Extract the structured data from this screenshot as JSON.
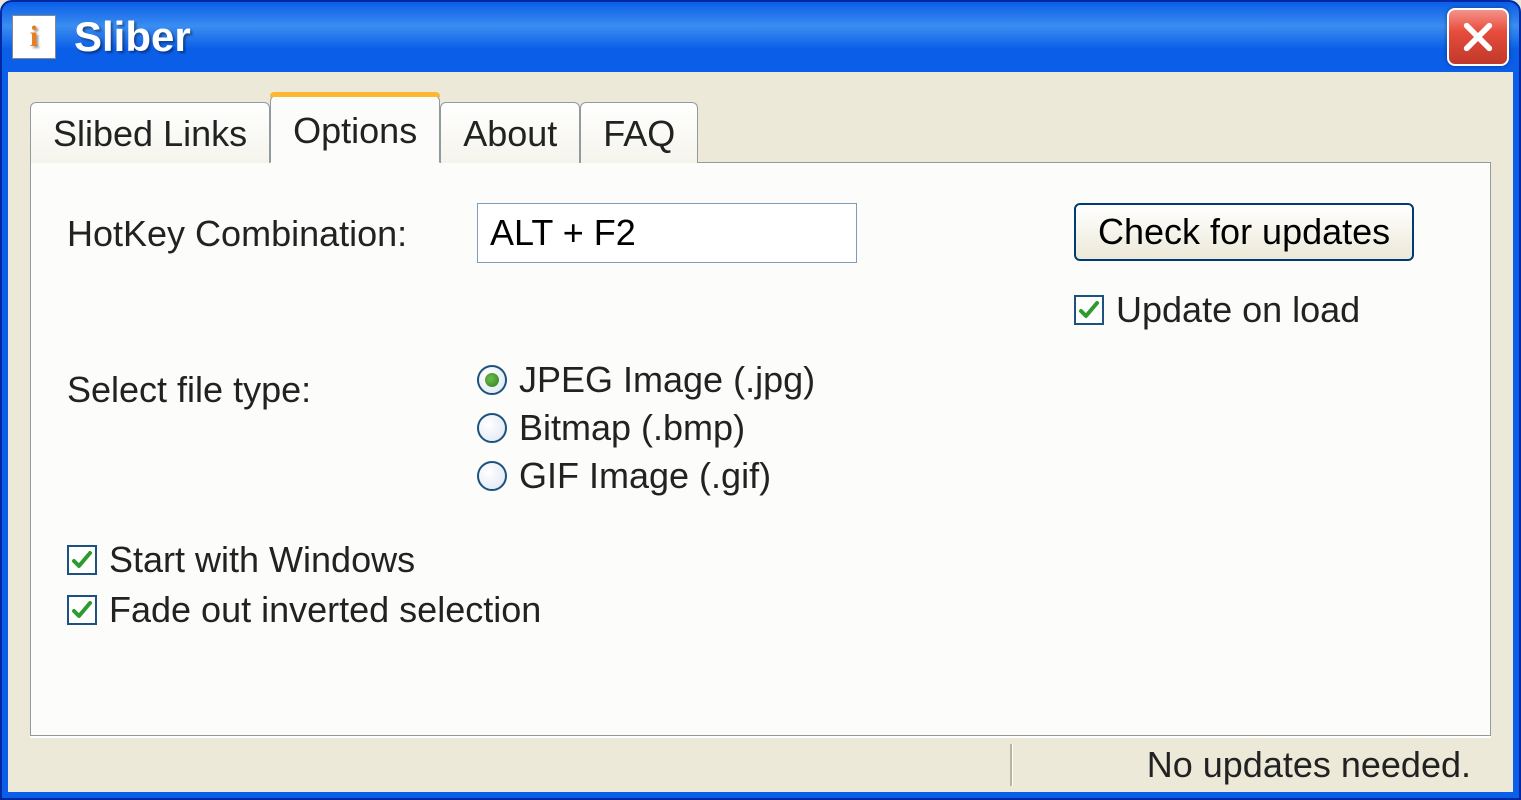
{
  "window": {
    "title": "Sliber"
  },
  "tabs": [
    {
      "label": "Slibed Links"
    },
    {
      "label": "Options"
    },
    {
      "label": "About"
    },
    {
      "label": "FAQ"
    }
  ],
  "options": {
    "hotkey_label": "HotKey Combination:",
    "hotkey_value": "ALT + F2",
    "filetype_label": "Select file type:",
    "filetypes": [
      {
        "label": "JPEG Image (.jpg)",
        "selected": true
      },
      {
        "label": "Bitmap (.bmp)",
        "selected": false
      },
      {
        "label": "GIF Image (.gif)",
        "selected": false
      }
    ],
    "check_updates_button": "Check for updates",
    "update_on_load_label": "Update on load",
    "start_with_windows_label": "Start with Windows",
    "fade_out_label": "Fade out inverted selection"
  },
  "status": {
    "text": "No updates needed."
  }
}
